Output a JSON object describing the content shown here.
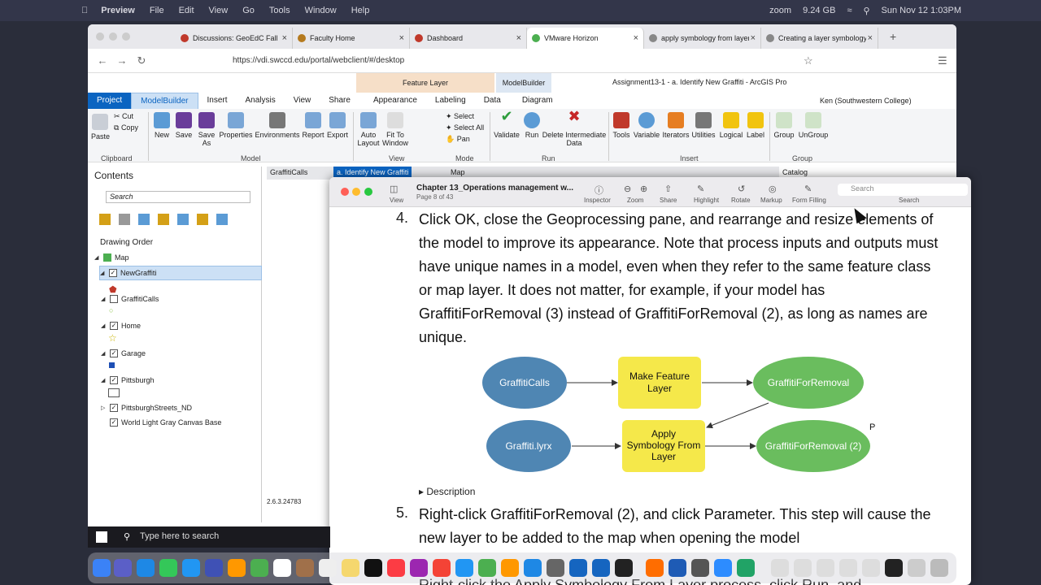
{
  "menubar": {
    "app": "Preview",
    "items": [
      "File",
      "Edit",
      "View",
      "Go",
      "Tools",
      "Window",
      "Help"
    ],
    "zoom": "zoom",
    "memory": "9.24 GB",
    "datetime": "Sun Nov 12  1:03PM"
  },
  "browser": {
    "tabs": [
      {
        "label": "Discussions: GeoEdC Fall",
        "color": "#c0392b"
      },
      {
        "label": "Faculty Home",
        "color": "#b57a1f"
      },
      {
        "label": "Dashboard",
        "color": "#c0392b"
      },
      {
        "label": "VMware Horizon",
        "color": "#4caf50",
        "active": true
      },
      {
        "label": "apply symbology from layer",
        "color": "#888"
      },
      {
        "label": "Creating a layer symbology file",
        "color": "#888"
      }
    ],
    "url": "https://vdi.swccd.edu/portal/webclient/#/desktop"
  },
  "arcgis": {
    "context_feature_layer": "Feature Layer",
    "context_modelbuilder": "ModelBuilder",
    "title": "Assignment13-1 - a. Identify New Graffiti - ArcGIS Pro",
    "user": "Ken (Southwestern College)",
    "ribbon_tabs": [
      "Project",
      "ModelBuilder",
      "Insert",
      "Analysis",
      "View",
      "Share",
      "Appearance",
      "Labeling",
      "Data",
      "Diagram"
    ],
    "buttons": {
      "paste": "Paste",
      "cut": "Cut",
      "copy": "Copy",
      "new": "New",
      "save": "Save",
      "save_as": "Save As",
      "properties": "Properties",
      "environments": "Environments",
      "report": "Report",
      "export": "Export",
      "auto_layout": "Auto Layout",
      "fit": "Fit To Window",
      "select": "Select",
      "select_all": "Select All",
      "pan": "Pan",
      "validate": "Validate",
      "run": "Run",
      "delete_int": "Delete Intermediate Data",
      "tools": "Tools",
      "variable": "Variable",
      "iterators": "Iterators",
      "utilities": "Utilities",
      "logical": "Logical",
      "label": "Label",
      "group": "Group",
      "ungroup": "UnGroup"
    },
    "groups": {
      "clipboard": "Clipboard",
      "model": "Model",
      "view": "View",
      "mode": "Mode",
      "run": "Run",
      "insert": "Insert",
      "group": "Group"
    },
    "contents": {
      "title": "Contents",
      "search": "Search",
      "drawing_order": "Drawing Order",
      "layers": [
        "Map",
        "NewGraffiti",
        "GraffitiCalls",
        "Home",
        "Garage",
        "Pittsburgh",
        "PittsburghStreets_ND",
        "World Light Gray Canvas Base"
      ]
    },
    "map_tabs": [
      "GraffitiCalls",
      "a. Identify New Graffiti",
      "Map"
    ],
    "catalog": "Catalog",
    "coord": "2.6.3.24783"
  },
  "pdf": {
    "title": "Chapter 13_Operations management w...",
    "page": "Page 8 of 43",
    "tools": [
      "View",
      "Inspector",
      "Zoom",
      "Share",
      "Highlight",
      "Rotate",
      "Markup",
      "Form Filling",
      "Search"
    ],
    "search_placeholder": "Search",
    "step4_num": "4.",
    "step4": "Click OK, close the Geoprocessing pane, and rearrange and resize elements of the model to improve its appearance. Note that process inputs and outputs must have unique names in a model, even when they refer to the same feature class or map layer. It does not matter, for example, if your model has GraffitiForRemoval (3) instead of GraffitiForRemoval (2), as long as names are unique.",
    "diagram": {
      "n1": "GraffitiCalls",
      "n2": "Make Feature Layer",
      "n3": "GraffitiForRemoval",
      "n4": "Graffiti.lyrx",
      "n5": "Apply Symbology From Layer",
      "n6": "GraffitiForRemoval (2)",
      "p": "P"
    },
    "description": "Description",
    "step5_num": "5.",
    "step5": "Right-click GraffitiForRemoval (2), and click Parameter. This step will cause the new layer to be added to the map when opening the model",
    "step6": "Right-click the Apply Symbology From Layer process, click Run, and"
  },
  "windows": {
    "search": "Type here to search"
  }
}
